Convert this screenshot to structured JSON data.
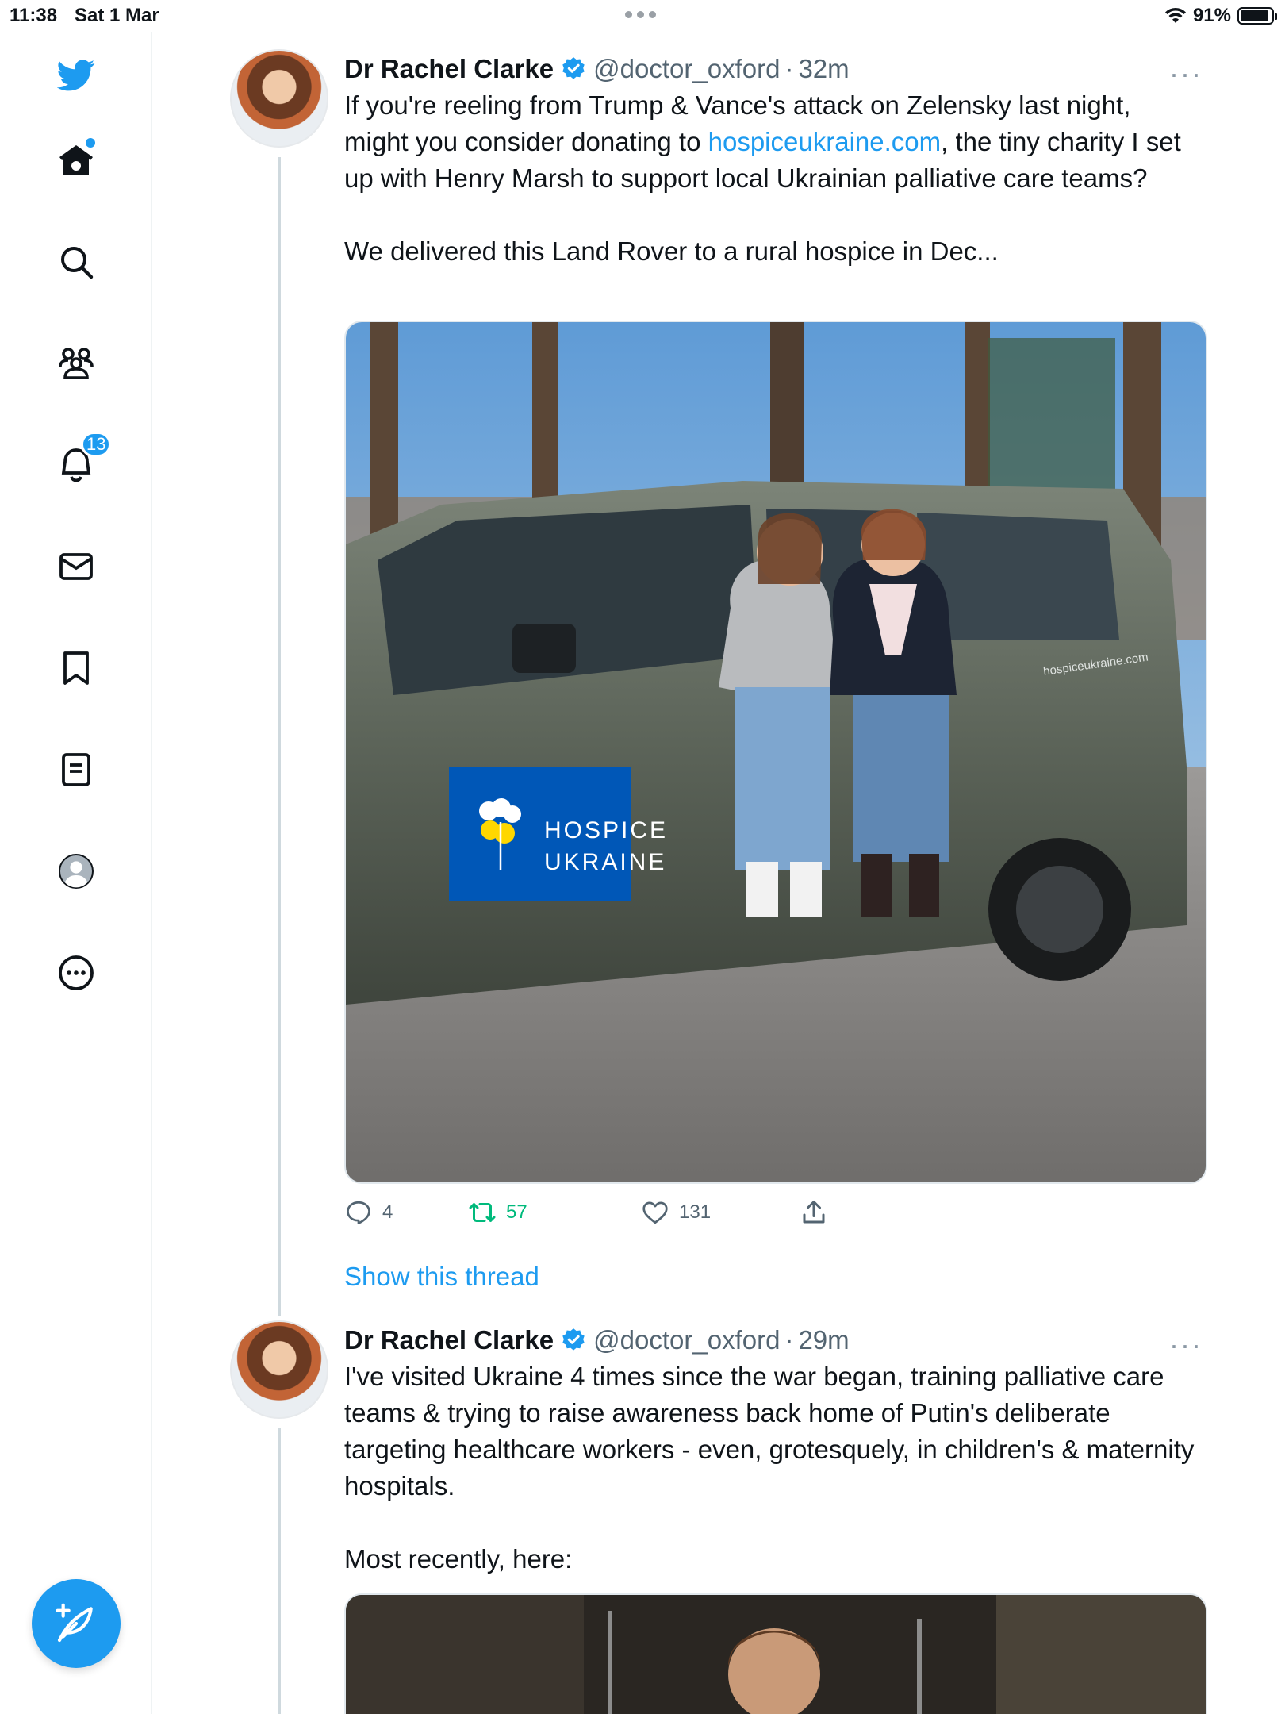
{
  "status_bar": {
    "time": "11:38",
    "date": "Sat 1 Mar",
    "battery": "91%",
    "battery_level": 0.91
  },
  "sidebar": {
    "items": [
      {
        "icon": "twitter-bird-icon"
      },
      {
        "icon": "home-icon",
        "has_dot": true
      },
      {
        "icon": "search-icon"
      },
      {
        "icon": "communities-icon"
      },
      {
        "icon": "notifications-icon",
        "badge": "13"
      },
      {
        "icon": "messages-icon"
      },
      {
        "icon": "bookmarks-icon"
      },
      {
        "icon": "lists-icon"
      },
      {
        "icon": "profile-icon"
      },
      {
        "icon": "more-icon"
      }
    ],
    "compose_icon": "compose-feather-icon"
  },
  "tweets": [
    {
      "name": "Dr Rachel Clarke",
      "handle": "@doctor_oxford",
      "separator": "·",
      "time": "32m",
      "text_before_link": "If you're reeling from Trump & Vance's attack on Zelensky last night, might you consider donating to ",
      "link": "hospiceukraine.com",
      "text_after_link": ", the tiny charity I set up with Henry Marsh to support local Ukrainian palliative care teams?",
      "text_paragraph_2": "We delivered this Land Rover to a rural hospice in Dec...",
      "media": {
        "sign_line_1": "HOSPICE",
        "sign_line_2": "UKRAINE",
        "car_decal": "hospiceukraine.com"
      },
      "replies": "4",
      "retweets": "57",
      "likes": "131",
      "show_thread": "Show this thread"
    },
    {
      "name": "Dr Rachel Clarke",
      "handle": "@doctor_oxford",
      "separator": "·",
      "time": "29m",
      "text": "I've visited Ukraine 4 times since the war began, training palliative care teams & trying to raise awareness back home of Putin's deliberate targeting healthcare workers - even, grotesquely, in children's & maternity hospitals.",
      "text_paragraph_2": "Most recently, here:"
    }
  ],
  "colors": {
    "accent": "#1d9bf0",
    "retweet_green": "#00ba7c",
    "muted": "#536471"
  }
}
